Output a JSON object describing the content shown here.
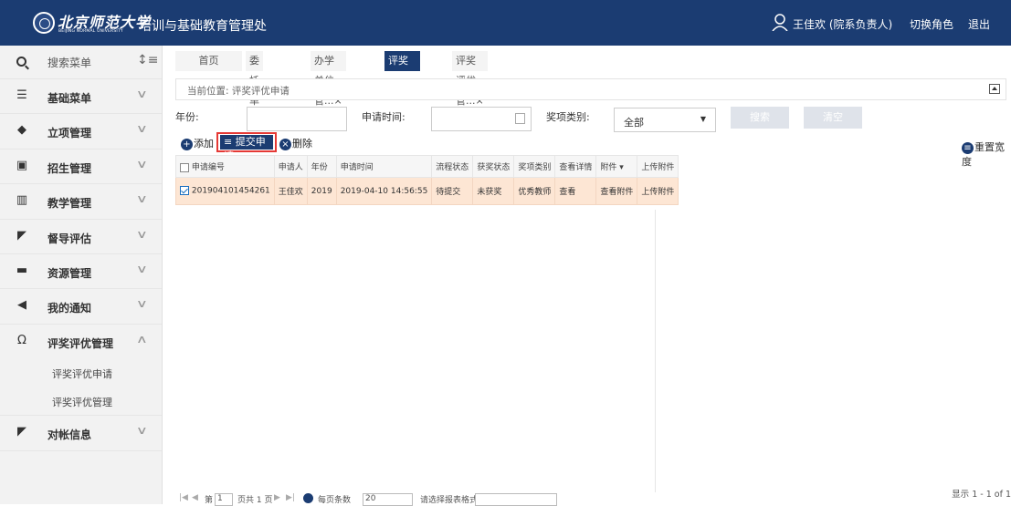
{
  "header": {
    "logo_text": "北京师范大学",
    "logo_en": "BEIJING NORMAL UNIVERSITY",
    "system_title": "培训与基础教育管理处",
    "user": "王佳欢 (院系负责人)",
    "switch_role": "切换角色",
    "logout": "退出"
  },
  "sidebar": {
    "search_label": "搜索菜单",
    "sort_glyph": "↕≡",
    "items": [
      {
        "label": "基础菜单",
        "icon": "☰",
        "chev": "∨"
      },
      {
        "label": "立项管理",
        "icon": "◆",
        "chev": "∨"
      },
      {
        "label": "招生管理",
        "icon": "▣",
        "chev": "∨"
      },
      {
        "label": "教学管理",
        "icon": "▥",
        "chev": "∨"
      },
      {
        "label": "督导评估",
        "icon": "◤",
        "chev": "∨"
      },
      {
        "label": "资源管理",
        "icon": "▬",
        "chev": "∨"
      },
      {
        "label": "我的通知",
        "icon": "◀",
        "chev": "∨"
      },
      {
        "label": "评奖评优管理",
        "icon": "Ω",
        "chev": "∧"
      }
    ],
    "subitems": [
      {
        "label": "评奖评优申请"
      },
      {
        "label": "评奖评优管理"
      }
    ],
    "last": {
      "label": "对帐信息",
      "icon": "◤",
      "chev": "∨"
    }
  },
  "tabs": [
    {
      "label": "首页"
    },
    {
      "label": "委托单位库×"
    },
    {
      "label": "办学单位管...×"
    },
    {
      "label": "评奖评优申...×"
    },
    {
      "label": "评奖评优管...×"
    }
  ],
  "breadcrumb": "当前位置: 评奖评优申请",
  "filters": {
    "year_label": "年份:",
    "date_label": "申请时间:",
    "type_label": "奖项类别:",
    "type_value": "全部",
    "search_btn": "搜索",
    "clear_btn": "清空",
    "dropdown_glyph": "▼"
  },
  "toolbar": {
    "add": "添加",
    "submit": "提交申请",
    "delete": "删除",
    "reset_width": "重置宽度",
    "add_glyph": "+",
    "delete_glyph": "×",
    "reset_glyph": "≡",
    "list_glyph": "≡"
  },
  "table": {
    "headers": [
      "申请编号",
      "申请人",
      "年份",
      "申请时间",
      "流程状态",
      "获奖状态",
      "奖项类别",
      "查看详情",
      "附件 ▾",
      "上传附件"
    ],
    "rows": [
      [
        "201904101454261",
        "王佳欢",
        "2019",
        "2019-04-10 14:56:55",
        "待提交",
        "未获奖",
        "优秀教师",
        "查看",
        "查看附件",
        "上传附件"
      ]
    ]
  },
  "footer": {
    "first": "|◀",
    "prev": "◀",
    "page_label": "第",
    "page_value": "1",
    "page_total": "页共 1 页",
    "next": "▶",
    "last": "▶|",
    "page_size_label": "每页条数",
    "page_size": "20",
    "format_label": "请选择报表格式",
    "display": "显示 1 - 1 of 1"
  }
}
